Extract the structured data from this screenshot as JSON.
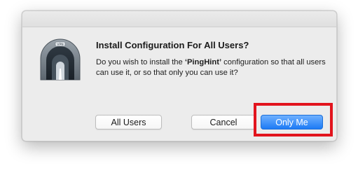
{
  "dialog": {
    "icon": "vpn-tunnel-icon",
    "icon_label": "VPN",
    "title": "Install Configuration For All Users?",
    "message_prefix": "Do you wish to install the ",
    "config_name": "‘PingHint’",
    "message_suffix": " configuration so that all users can use it, or so that only you can use it?"
  },
  "buttons": {
    "all_users": "All Users",
    "cancel": "Cancel",
    "only_me": "Only Me"
  },
  "colors": {
    "primary_button": "#1d7bf5",
    "highlight": "#e2141d",
    "dialog_background": "#ececec"
  }
}
